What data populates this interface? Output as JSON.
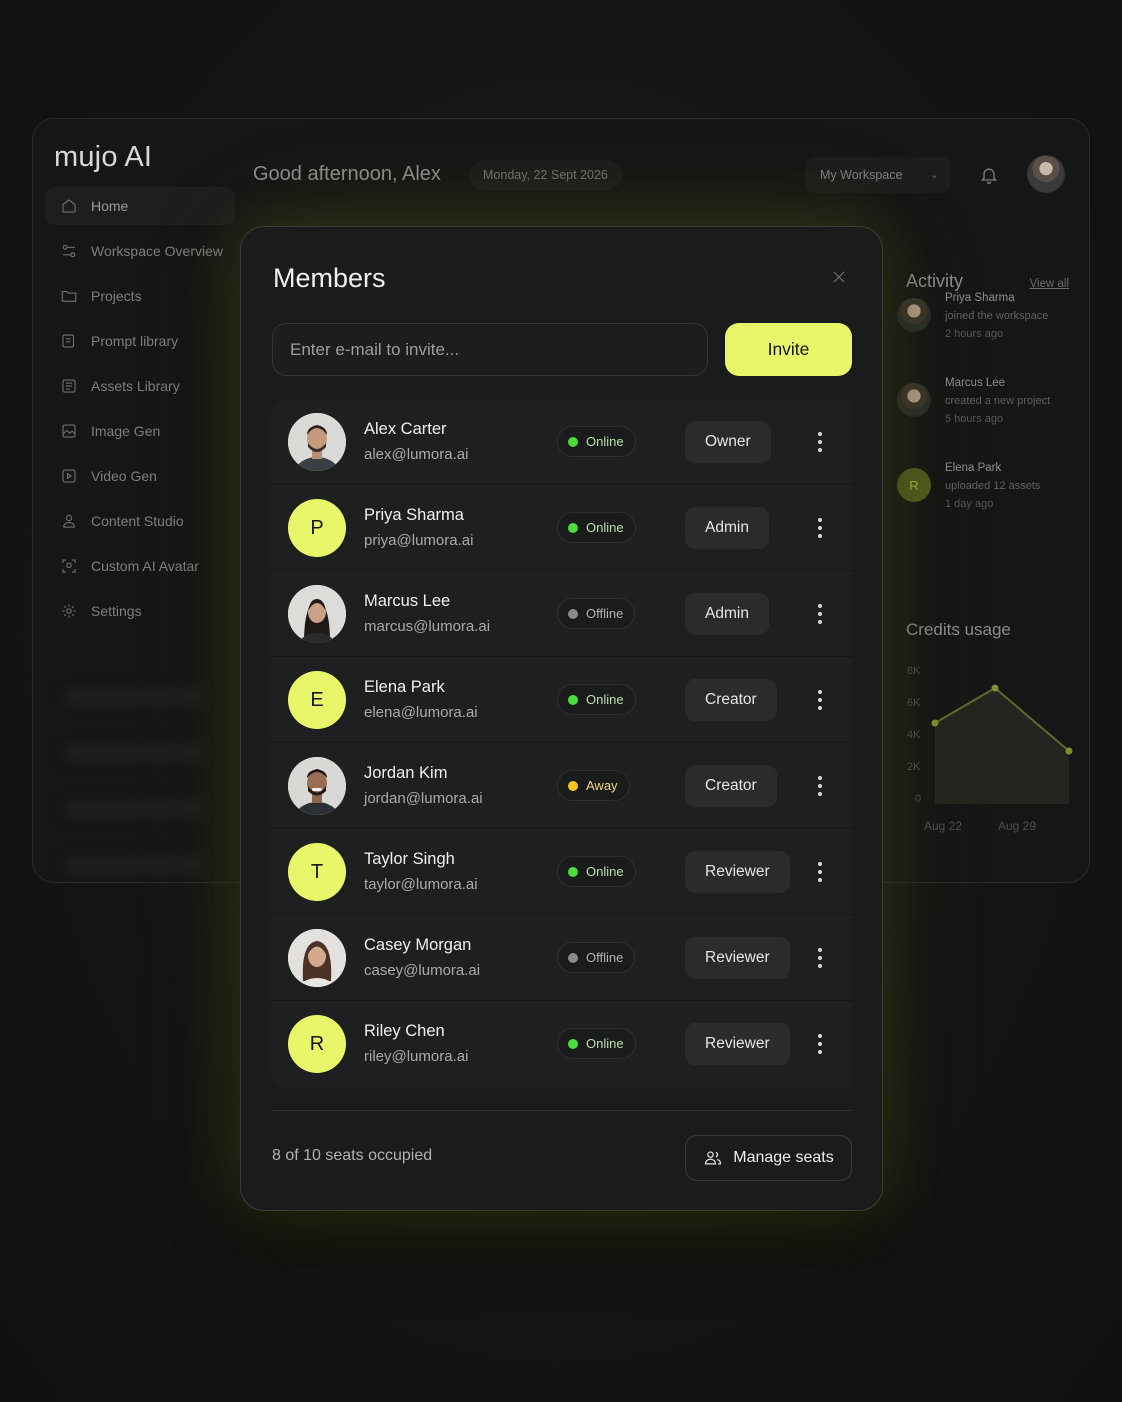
{
  "app": {
    "logo": "mujo AI",
    "greeting": "Good afternoon, Alex",
    "date": "Monday, 22 Sept 2026",
    "workspace": "My Workspace"
  },
  "sidebar": {
    "items": [
      {
        "label": "Home",
        "icon": "home-icon"
      },
      {
        "label": "Workspace Overview",
        "icon": "sliders-icon"
      },
      {
        "label": "Projects",
        "icon": "folder-icon"
      },
      {
        "label": "Prompt library",
        "icon": "book-icon"
      },
      {
        "label": "Assets Library",
        "icon": "library-icon"
      },
      {
        "label": "Image Gen",
        "icon": "image-icon"
      },
      {
        "label": "Video Gen",
        "icon": "video-icon"
      },
      {
        "label": "Content Studio",
        "icon": "user-icon"
      },
      {
        "label": "Custom AI Avatar",
        "icon": "face-scan-icon"
      },
      {
        "label": "Settings",
        "icon": "gear-icon"
      }
    ]
  },
  "activity": {
    "title": "Activity",
    "view_all": "View all",
    "items": [
      {
        "name": "Priya Sharma",
        "desc": "joined the workspace",
        "time": "2 hours ago"
      },
      {
        "name": "Marcus Lee",
        "desc": "created a new project",
        "time": "5 hours ago"
      },
      {
        "name": "Elena Park",
        "desc": "uploaded 12 assets",
        "time": "1 day ago",
        "initial": "R"
      }
    ]
  },
  "credits": {
    "title": "Credits usage",
    "y_ticks": [
      "8K",
      "6K",
      "4K",
      "2K",
      "0"
    ],
    "x_ticks": [
      "Aug 22",
      "Aug 29"
    ]
  },
  "modal": {
    "title": "Members",
    "invite_placeholder": "Enter e-mail to invite...",
    "invite_label": "Invite",
    "seats_text": "8 of 10 seats occupied",
    "manage_label": "Manage seats",
    "members": [
      {
        "name": "Alex Carter",
        "email": "alex@lumora.ai",
        "status": "Online",
        "role": "Owner",
        "avatar": "photo"
      },
      {
        "name": "Priya Sharma",
        "email": "priya@lumora.ai",
        "status": "Online",
        "role": "Admin",
        "avatar": "P"
      },
      {
        "name": "Marcus Lee",
        "email": "marcus@lumora.ai",
        "status": "Offline",
        "role": "Admin",
        "avatar": "photo"
      },
      {
        "name": "Elena Park",
        "email": "elena@lumora.ai",
        "status": "Online",
        "role": "Creator",
        "avatar": "E"
      },
      {
        "name": "Jordan Kim",
        "email": "jordan@lumora.ai",
        "status": "Away",
        "role": "Creator",
        "avatar": "photo"
      },
      {
        "name": "Taylor Singh",
        "email": "taylor@lumora.ai",
        "status": "Online",
        "role": "Reviewer",
        "avatar": "T"
      },
      {
        "name": "Casey Morgan",
        "email": "casey@lumora.ai",
        "status": "Offline",
        "role": "Reviewer",
        "avatar": "photo"
      },
      {
        "name": "Riley Chen",
        "email": "riley@lumora.ai",
        "status": "Online",
        "role": "Reviewer",
        "avatar": "R"
      }
    ]
  },
  "colors": {
    "accent": "#e8f76a",
    "online": "#4ade3a",
    "online_text": "#b8e0a8",
    "offline": "#8a8b8b",
    "offline_text": "#b0b1b1",
    "away": "#f5c518",
    "away_text": "#f2d37a"
  }
}
